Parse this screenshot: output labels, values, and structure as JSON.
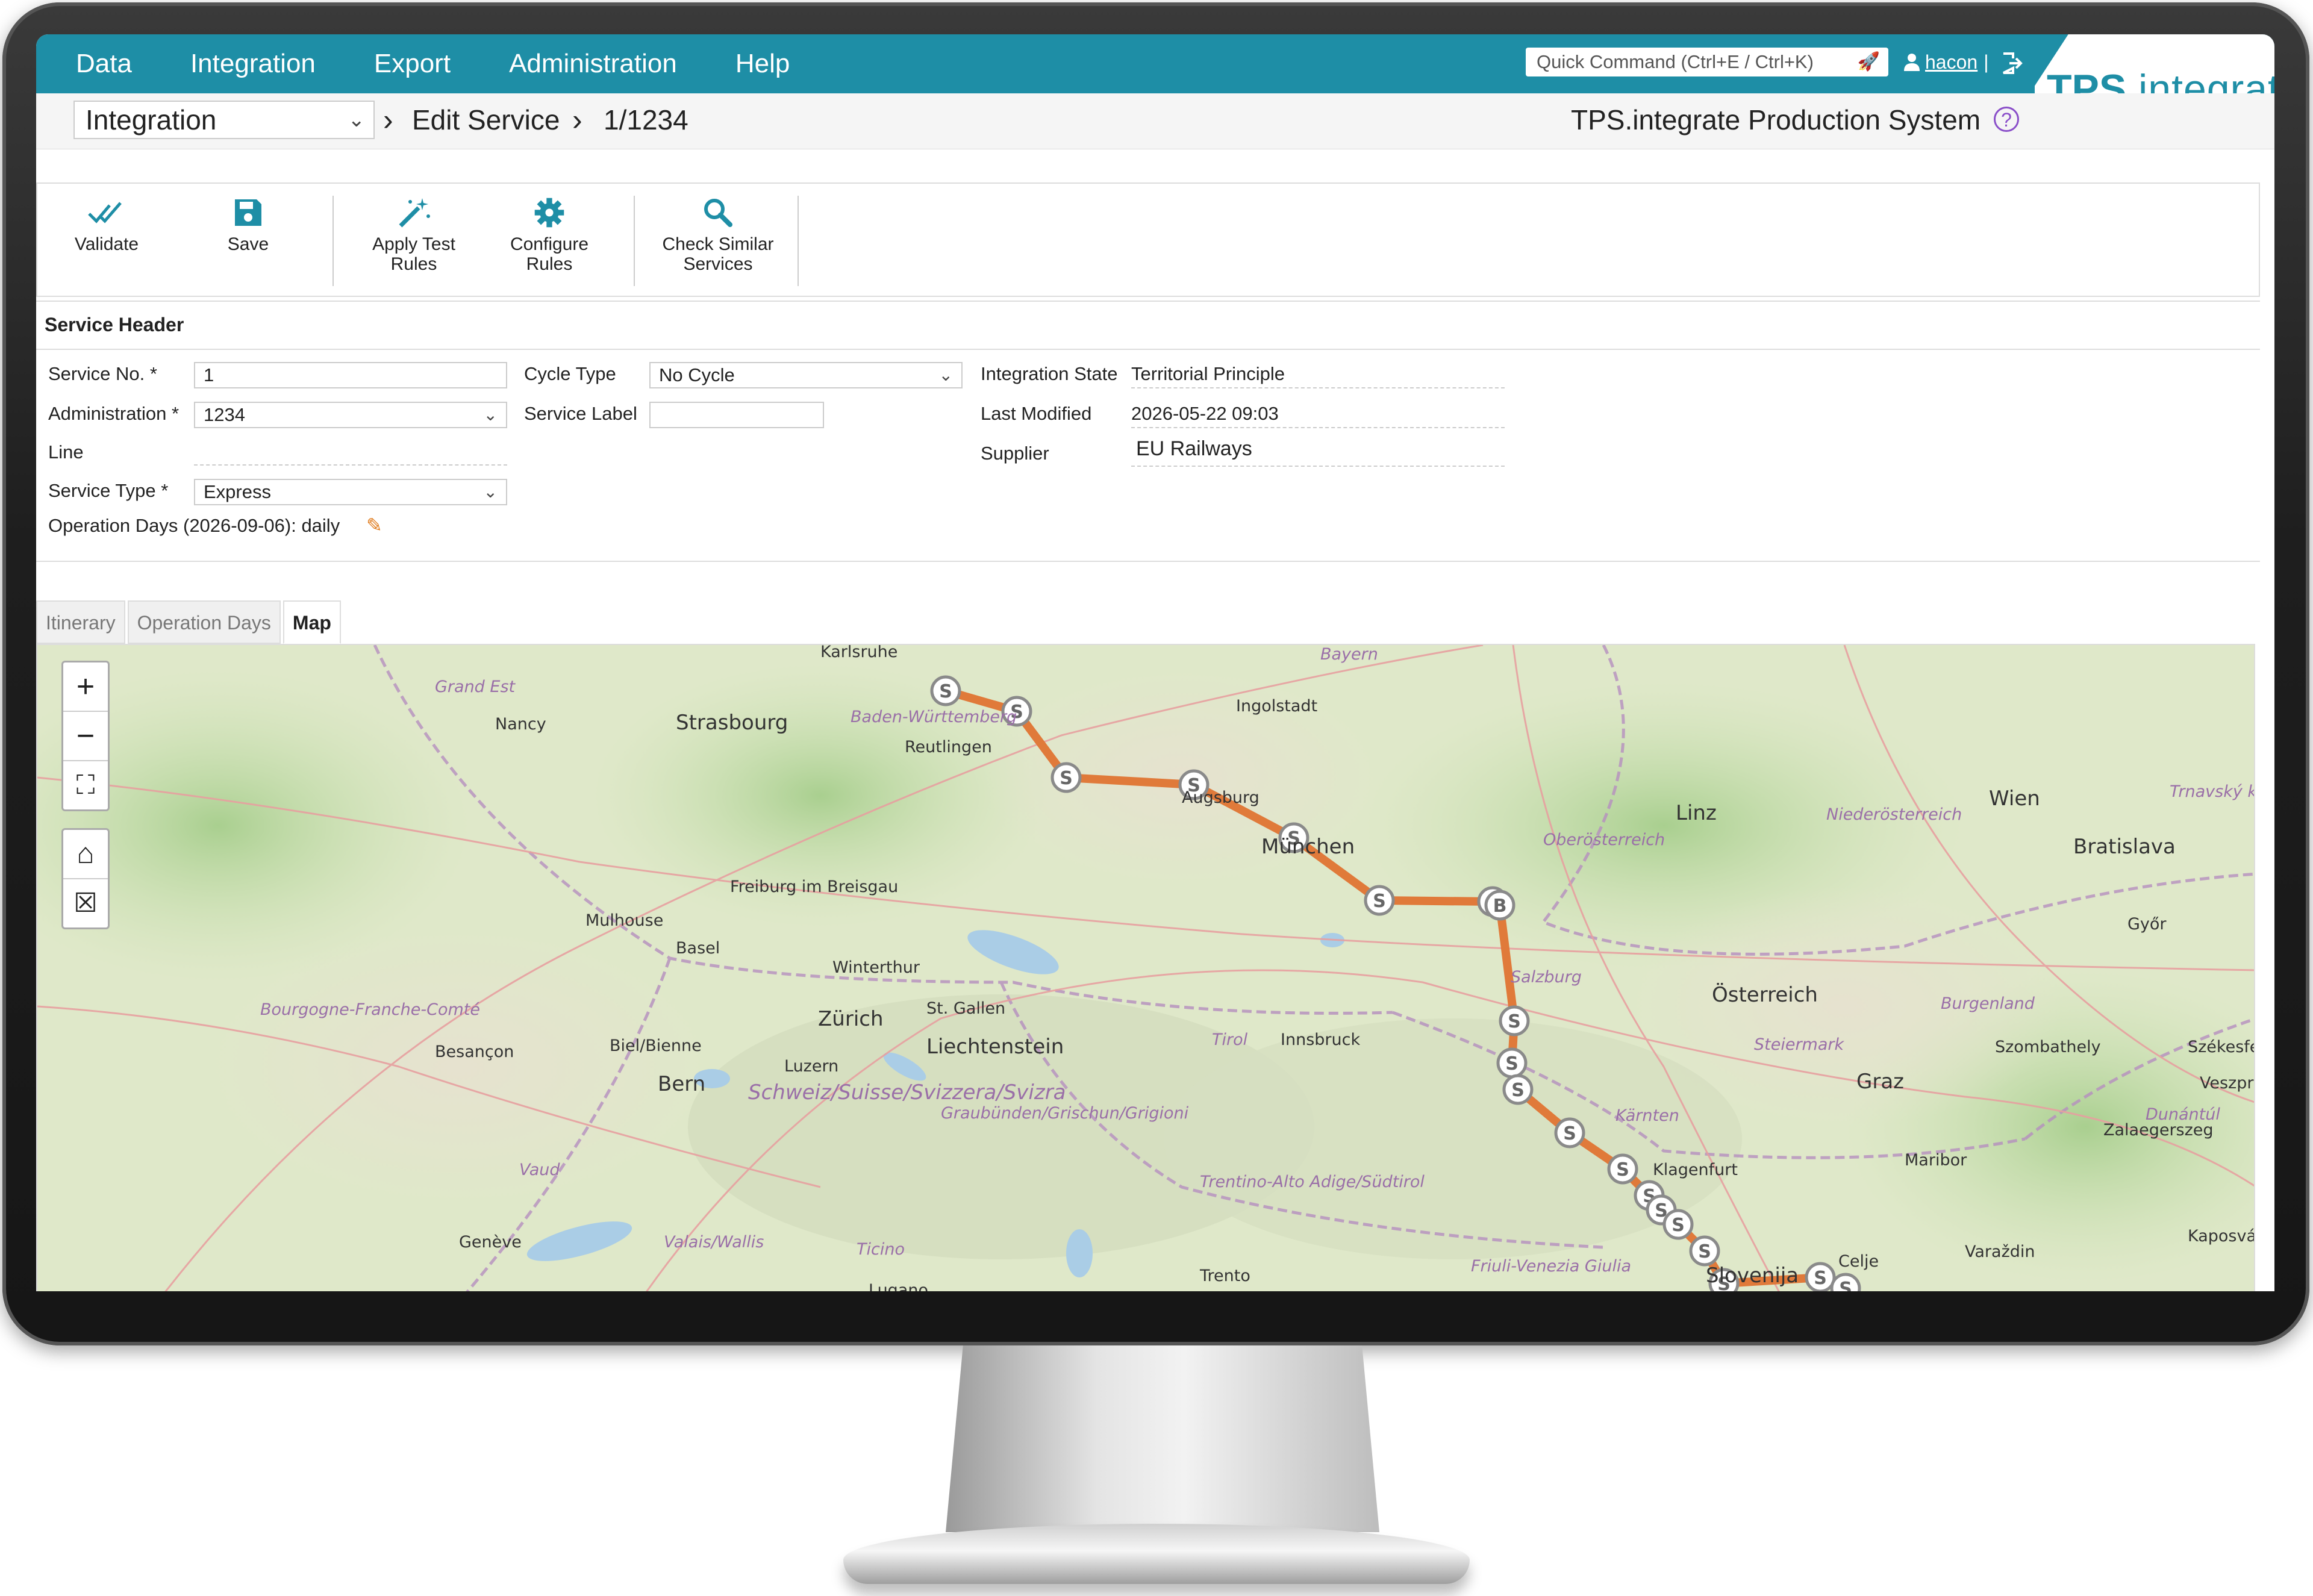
{
  "nav": {
    "menu": [
      "Data",
      "Integration",
      "Export",
      "Administration",
      "Help"
    ],
    "quick_command_placeholder": "Quick Command (Ctrl+E / Ctrl+K)",
    "user": "hacon",
    "user_sep": "|"
  },
  "logo": {
    "brand": "TPS",
    "rest": ".integrate"
  },
  "breadcrumb": {
    "module": "Integration",
    "page": "Edit Service",
    "item": "1/1234"
  },
  "system_name": "TPS.integrate Production System",
  "toolbar": {
    "validate": "Validate",
    "save": "Save",
    "apply_test_rules": [
      "Apply Test",
      "Rules"
    ],
    "configure_rules": [
      "Configure",
      "Rules"
    ],
    "check_similar": [
      "Check Similar",
      "Services"
    ]
  },
  "service_header": {
    "title": "Service Header",
    "service_no_label": "Service No. *",
    "service_no": "1",
    "administration_label": "Administration *",
    "administration": "1234",
    "line_label": "Line",
    "service_type_label": "Service Type *",
    "service_type": "Express",
    "operation_days_label": "Operation Days (2026-09-06): daily",
    "cycle_type_label": "Cycle Type",
    "cycle_type": "No Cycle",
    "service_label_label": "Service Label",
    "integration_state_label": "Integration State",
    "integration_state": "Territorial Principle",
    "last_modified_label": "Last Modified",
    "last_modified": "2026-05-22 09:03",
    "supplier_label": "Supplier",
    "supplier": "EU Railways"
  },
  "tabs": [
    "Itinerary",
    "Operation Days",
    "Map"
  ],
  "active_tab": "Map",
  "map": {
    "controls": {
      "zoom_in": "+",
      "zoom_out": "−",
      "fullscreen": "⛶",
      "home": "⌂",
      "clear": "☒"
    },
    "stop_letter": "S",
    "border_letter": "B",
    "route_color": "#e07a3a",
    "place_labels": [
      "Karlsruhe",
      "Bayern",
      "Grand Est",
      "Nancy",
      "Strasbourg",
      "Baden-Württemberg",
      "Reutlingen",
      "Ingolstadt",
      "Augsburg",
      "München",
      "Linz",
      "Niederösterreich",
      "Wien",
      "Bratislava",
      "Oberösterreich",
      "Freiburg im Breisgau",
      "Mulhouse",
      "Basel",
      "Winterthur",
      "St. Gallen",
      "Zürich",
      "Liechtenstein",
      "Österreich",
      "Salzburg",
      "Tirol",
      "Innsbruck",
      "Bourgogne-Franche-Comté",
      "Besançon",
      "Biel/Bienne",
      "Luzern",
      "Bern",
      "Schweiz/Suisse/Svizzera/Svizra",
      "Graubünden/Grischun/Grigioni",
      "Steiermark",
      "Graz",
      "Burgenland",
      "Szombathely",
      "Kärnten",
      "Klagenfurt",
      "Maribor",
      "Zalaegerszeg",
      "Vaud",
      "Genève",
      "Valais/Wallis",
      "Ticino",
      "Lugano",
      "Trentino-Alto Adige/Südtirol",
      "Trento",
      "Friuli-Venezia Giulia",
      "Slovenija",
      "Celje",
      "Varaždin",
      "Kaposvár",
      "Győr",
      "Székesfe",
      "Veszpr",
      "Dunántúl",
      "Trnavský kraj"
    ]
  }
}
